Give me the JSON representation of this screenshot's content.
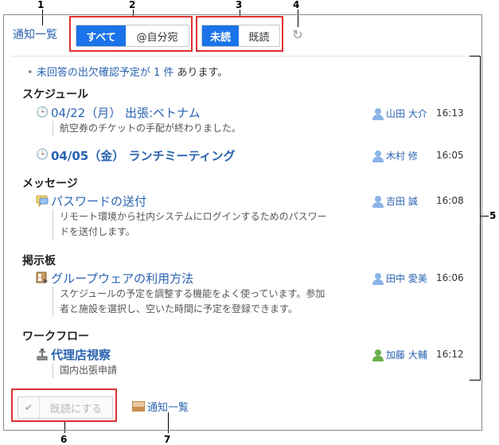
{
  "callouts": [
    "1",
    "2",
    "3",
    "4",
    "5",
    "6",
    "7"
  ],
  "header": {
    "title_link": "通知一覧",
    "filter_all": "すべて",
    "filter_mine": "@自分宛",
    "unread": "未読",
    "read": "既読",
    "refresh_icon": "refresh-icon"
  },
  "notice": {
    "bullet": "•",
    "link_text": "未回答の出欠確認予定が 1 件",
    "suffix": "あります。"
  },
  "sections": {
    "schedule": "スケジュール",
    "message": "メッセージ",
    "bulletin": "掲示板",
    "workflow": "ワークフロー"
  },
  "items": [
    {
      "icon": "clock-arrow-icon",
      "title": "04/22（月） 出張:ベトナム",
      "bold": false,
      "body": "航空券のチケットの手配が終わりました。",
      "user": "山田 大介",
      "time": "16:13"
    },
    {
      "icon": "clock-icon",
      "title": "04/05（金） ランチミーティング",
      "bold": true,
      "body": "",
      "user": "木村 修",
      "time": "16:05"
    },
    {
      "icon": "speech-bubble-icon",
      "title": "パスワードの送付",
      "bold": false,
      "body": "リモート環境から社内システムにログインするためのパスワードを送付します。",
      "user": "吉田 誠",
      "time": "16:08"
    },
    {
      "icon": "bulletin-icon",
      "title": "グループウェアの利用方法",
      "bold": false,
      "body": "スケジュールの予定を調整する機能をよく使っています。参加者と施設を選択し、空いた時間に予定を登録できます。",
      "user": "田中 愛美",
      "time": "16:06"
    },
    {
      "icon": "workflow-icon",
      "title": "代理店視察",
      "bold": true,
      "body": "国内出張申請",
      "user": "加藤 大輔",
      "time": "16:12"
    }
  ],
  "footer": {
    "mark_read": "既読にする",
    "list_link": "通知一覧"
  }
}
